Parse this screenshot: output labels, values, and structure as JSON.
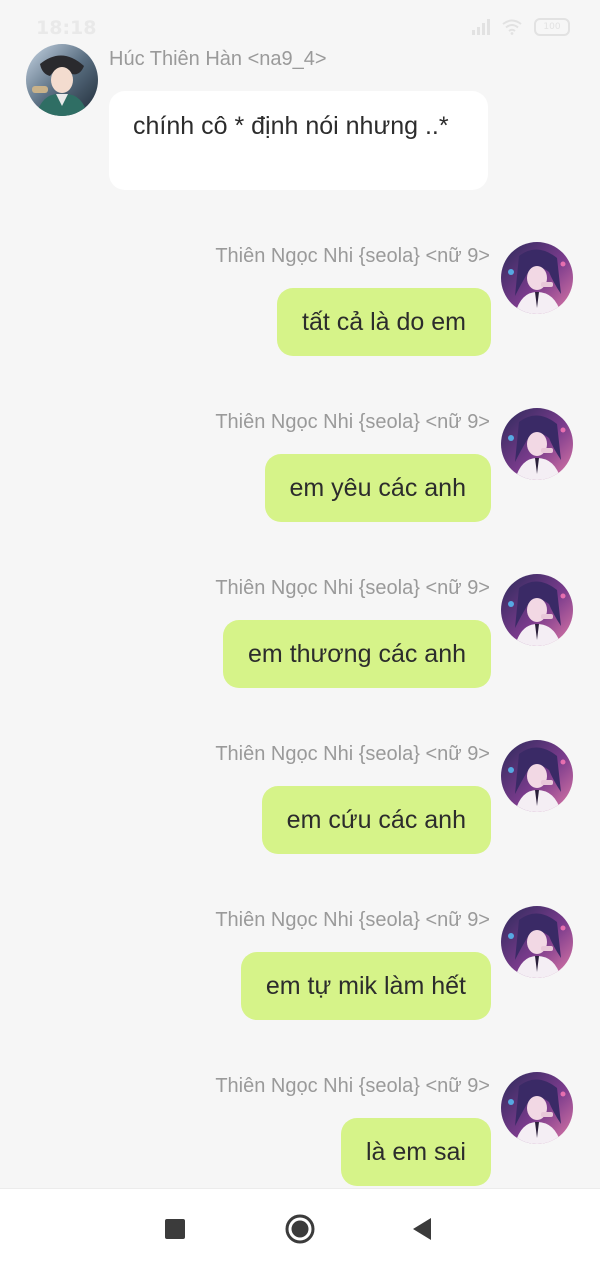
{
  "status_bar": {
    "time": "18:18",
    "battery": "100"
  },
  "incoming": {
    "sender": "Húc Thiên Hàn <na9_4>",
    "text": "chính cô * định nói nhưng ..*"
  },
  "outgoing_sender": "Thiên Ngọc Nhi {seola} <nữ 9>",
  "messages": [
    {
      "sender": "Thiên Ngọc Nhi {seola} <nữ 9>",
      "text": "tất cả là do em"
    },
    {
      "sender": "Thiên Ngọc Nhi {seola} <nữ 9>",
      "text": "em yêu các anh"
    },
    {
      "sender": "Thiên Ngọc Nhi {seola} <nữ 9>",
      "text": "em thương các anh"
    },
    {
      "sender": "Thiên Ngọc Nhi {seola} <nữ 9>",
      "text": "em cứu các anh"
    },
    {
      "sender": "Thiên Ngọc Nhi {seola} <nữ 9>",
      "text": "em tự mik làm hết"
    },
    {
      "sender": "Thiên Ngọc Nhi {seola} <nữ 9>",
      "text": "là em sai"
    }
  ],
  "colors": {
    "background": "#f6f6f6",
    "outgoing_bubble": "#d6f389",
    "incoming_bubble": "#ffffff",
    "sender_text": "#9a9a9a"
  },
  "icons": {
    "nav_recent": "square-icon",
    "nav_home": "circle-icon",
    "nav_back": "triangle-back-icon"
  }
}
